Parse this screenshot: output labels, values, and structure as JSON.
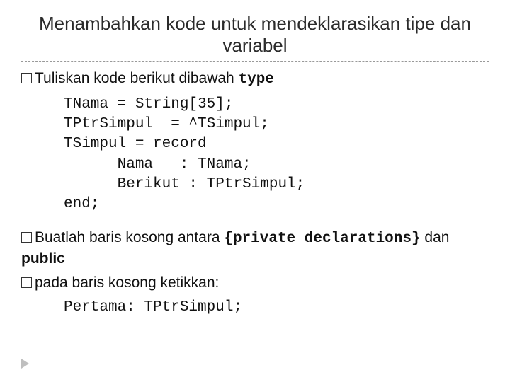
{
  "title": "Menambahkan kode untuk mendeklarasikan tipe dan variabel",
  "b1": {
    "lead": "Tuliskan kode berikut dibawah ",
    "kw": "type"
  },
  "code1": {
    "l1": "TNama = String[35];",
    "l2": "TPtrSimpul  = ^TSimpul;",
    "l3": "TSimpul = record",
    "l4": "      Nama   : TNama;",
    "l5": "      Berikut : TPtrSimpul;",
    "l6": "end;"
  },
  "b2": {
    "lead": "Buatlah baris kosong antara ",
    "tok1": "{private declarations}",
    "mid": "  dan ",
    "tok2": "public"
  },
  "b3": {
    "lead": "pada baris kosong ketikkan:"
  },
  "code2": {
    "l1": "Pertama: TPtrSimpul;"
  }
}
